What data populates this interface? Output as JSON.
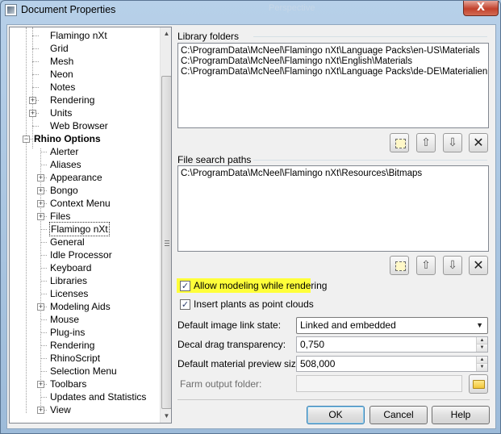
{
  "window": {
    "title": "Document Properties",
    "ghost_title": "Perspective",
    "close_glyph": "X"
  },
  "tree": {
    "items": [
      {
        "label": "Flamingo nXt",
        "level": 2,
        "expander": false
      },
      {
        "label": "Grid",
        "level": 2,
        "expander": false
      },
      {
        "label": "Mesh",
        "level": 2,
        "expander": false
      },
      {
        "label": "Neon",
        "level": 2,
        "expander": false
      },
      {
        "label": "Notes",
        "level": 2,
        "expander": false
      },
      {
        "label": "Rendering",
        "level": 2,
        "expander": true
      },
      {
        "label": "Units",
        "level": 2,
        "expander": true
      },
      {
        "label": "Web Browser",
        "level": 2,
        "expander": false
      },
      {
        "label": "Rhino Options",
        "level": 1,
        "expander": true,
        "expanded": true,
        "bold": true
      },
      {
        "label": "Alerter",
        "level": 2,
        "expander": false
      },
      {
        "label": "Aliases",
        "level": 2,
        "expander": false
      },
      {
        "label": "Appearance",
        "level": 2,
        "expander": true
      },
      {
        "label": "Bongo",
        "level": 2,
        "expander": true
      },
      {
        "label": "Context Menu",
        "level": 2,
        "expander": true
      },
      {
        "label": "Files",
        "level": 2,
        "expander": true
      },
      {
        "label": "Flamingo nXt",
        "level": 2,
        "expander": false,
        "selected": true
      },
      {
        "label": "General",
        "level": 2,
        "expander": false
      },
      {
        "label": "Idle Processor",
        "level": 2,
        "expander": false
      },
      {
        "label": "Keyboard",
        "level": 2,
        "expander": false
      },
      {
        "label": "Libraries",
        "level": 2,
        "expander": false
      },
      {
        "label": "Licenses",
        "level": 2,
        "expander": false
      },
      {
        "label": "Modeling Aids",
        "level": 2,
        "expander": true
      },
      {
        "label": "Mouse",
        "level": 2,
        "expander": false
      },
      {
        "label": "Plug-ins",
        "level": 2,
        "expander": false
      },
      {
        "label": "Rendering",
        "level": 2,
        "expander": false
      },
      {
        "label": "RhinoScript",
        "level": 2,
        "expander": false
      },
      {
        "label": "Selection Menu",
        "level": 2,
        "expander": false
      },
      {
        "label": "Toolbars",
        "level": 2,
        "expander": true
      },
      {
        "label": "Updates and Statistics",
        "level": 2,
        "expander": false
      },
      {
        "label": "View",
        "level": 2,
        "expander": true
      }
    ]
  },
  "library_folders": {
    "label": "Library folders",
    "items": [
      "C:\\ProgramData\\McNeel\\Flamingo nXt\\Language Packs\\en-US\\Materials",
      "C:\\ProgramData\\McNeel\\Flamingo nXt\\English\\Materials",
      "C:\\ProgramData\\McNeel\\Flamingo nXt\\Language Packs\\de-DE\\Materialien"
    ]
  },
  "file_search_paths": {
    "label": "File search paths",
    "items": [
      "C:\\ProgramData\\McNeel\\Flamingo nXt\\Resources\\Bitmaps"
    ]
  },
  "toolbar_glyphs": {
    "up": "⇧",
    "down": "⇩",
    "delete": "✕"
  },
  "options": {
    "allow_modeling": {
      "label": "Allow modeling while rendering",
      "checked": true
    },
    "insert_plants": {
      "label": "Insert plants as point clouds",
      "checked": true
    },
    "check_glyph": "✓"
  },
  "fields": {
    "image_link_state": {
      "label": "Default image link state:",
      "value": "Linked and embedded"
    },
    "decal_drag": {
      "label": "Decal drag transparency:",
      "value": "0,750"
    },
    "material_preview": {
      "label": "Default material preview size:",
      "value": "508,000"
    },
    "farm_output": {
      "label": "Farm output folder:",
      "value": ""
    }
  },
  "buttons": {
    "ok": "OK",
    "cancel": "Cancel",
    "help": "Help"
  }
}
